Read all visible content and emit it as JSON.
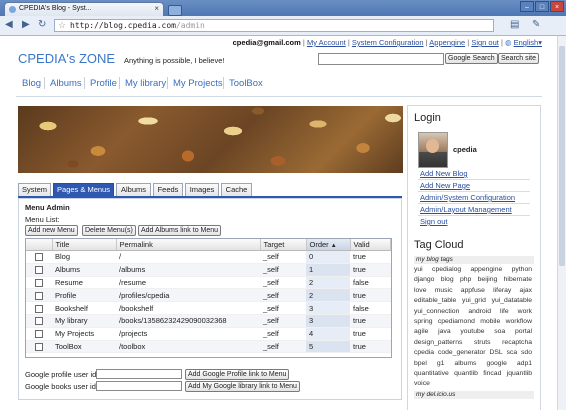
{
  "browser": {
    "tab_title": "CPEDIA's Blog - Syst...",
    "url_main": "http://blog.cpedia.com",
    "url_rest": "/admin",
    "close_glyph": "×"
  },
  "userbar": {
    "email": "cpedia@gmail.com",
    "my_account": "My Account",
    "system_config": "System Configuration",
    "appengine": "Appengine",
    "sign_out": "Sign out",
    "language": "English▾"
  },
  "header": {
    "logo": "CPEDIA's ZONE",
    "tagline": "Anything is possible, I believe!",
    "google_search": "Google Search",
    "search_site": "Search site"
  },
  "mainnav": [
    "Blog",
    "Albums",
    "Profile",
    "My library",
    "My Projects",
    "ToolBox"
  ],
  "tabs": [
    "System",
    "Pages & Menus",
    "Albums",
    "Feeds",
    "Images",
    "Cache"
  ],
  "menu_admin": {
    "title": "Menu Admin",
    "list_label": "Menu List:",
    "buttons": [
      "Add new Menu",
      "Delete Menu(s)",
      "Add Albums link to Menu"
    ],
    "columns": [
      "Title",
      "Permalink",
      "Target",
      "Order",
      "Valid"
    ],
    "sort_glyph": "▲",
    "rows": [
      {
        "title": "Blog",
        "permalink": "/",
        "target": "_self",
        "order": "0",
        "valid": "true"
      },
      {
        "title": "Albums",
        "permalink": "/albums",
        "target": "_self",
        "order": "1",
        "valid": "true"
      },
      {
        "title": "Resume",
        "permalink": "/resume",
        "target": "_self",
        "order": "2",
        "valid": "false"
      },
      {
        "title": "Profile",
        "permalink": "/profiles/cpedia",
        "target": "_self",
        "order": "2",
        "valid": "true"
      },
      {
        "title": "Bookshelf",
        "permalink": "/bookshelf",
        "target": "_self",
        "order": "3",
        "valid": "false"
      },
      {
        "title": "My library",
        "permalink": "/books/13586232429090032368",
        "target": "_self",
        "order": "3",
        "valid": "true"
      },
      {
        "title": "My Projects",
        "permalink": "/projects",
        "target": "_self",
        "order": "4",
        "valid": "true"
      },
      {
        "title": "ToolBox",
        "permalink": "/toolbox",
        "target": "_self",
        "order": "5",
        "valid": "true"
      }
    ],
    "google_profile_label": "Google profile user id:",
    "google_profile_button": "Add Google Profile link to Menu",
    "google_books_label": "Google books user id:",
    "google_books_button": "Add My Google library link to Menu"
  },
  "sidebar": {
    "login_title": "Login",
    "username": "cpedia",
    "links": [
      "Add New Blog",
      "Add New Page",
      "Admin/System Configuration",
      "Admin/Layout Management",
      "Sign out"
    ],
    "tag_cloud_title": "Tag Cloud",
    "blog_tags_label": "my blog tags",
    "tags": [
      "yui",
      "cpedialog",
      "appengine",
      "python",
      "django",
      "blog",
      "php",
      "beijing",
      "hibernate",
      "love",
      "music",
      "appfuse",
      "liferay",
      "ajax",
      "editable_table",
      "yui_grid",
      "yui_datatable",
      "yui_connection",
      "android",
      "life",
      "work",
      "spring",
      "cpediamond",
      "mobile",
      "workflow",
      "agile",
      "java",
      "youtube",
      "soa",
      "portal",
      "design_patterns",
      "struts",
      "recaptcha",
      "cpedia",
      "code_generator",
      "DSL",
      "sca",
      "sdo",
      "bpel",
      "g1",
      "albums",
      "google",
      "adp1",
      "quantitative",
      "quantlib",
      "fincad",
      "jquantlib",
      "voice"
    ],
    "delicious_label": "my del.icio.us"
  }
}
